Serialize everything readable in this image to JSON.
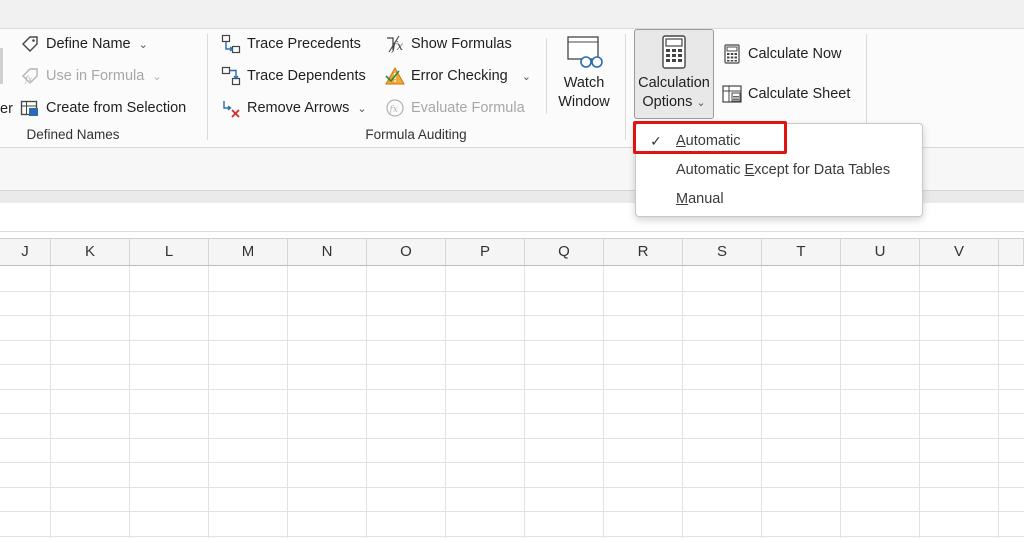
{
  "ribbon": {
    "defined_names": {
      "left_partial": "er",
      "define_name": "Define Name",
      "use_in_formula": "Use in Formula",
      "create_from_selection": "Create from Selection",
      "group_label": "Defined Names"
    },
    "formula_auditing": {
      "trace_precedents": "Trace Precedents",
      "trace_dependents": "Trace Dependents",
      "remove_arrows": "Remove Arrows",
      "show_formulas": "Show Formulas",
      "error_checking": "Error Checking",
      "evaluate_formula": "Evaluate Formula",
      "watch_window_line1": "Watch",
      "watch_window_line2": "Window",
      "group_label": "Formula Auditing"
    },
    "calculation": {
      "options_line1": "Calculation",
      "options_line2": "Options",
      "calculate_now": "Calculate Now",
      "calculate_sheet": "Calculate Sheet"
    }
  },
  "dropdown": {
    "items": [
      {
        "label_pre": "",
        "label_ul": "A",
        "label_post": "utomatic",
        "checked": true
      },
      {
        "label_pre": "Automatic ",
        "label_ul": "E",
        "label_post": "xcept for Data Tables",
        "checked": false
      },
      {
        "label_pre": "",
        "label_ul": "M",
        "label_post": "anual",
        "checked": false
      }
    ]
  },
  "grid": {
    "columns": [
      "J",
      "K",
      "L",
      "M",
      "N",
      "O",
      "P",
      "Q",
      "R",
      "S",
      "T",
      "U",
      "V"
    ]
  },
  "colors": {
    "highlight": "#e11212",
    "icon_blue": "#2b6cb0",
    "error_orange": "#d4730b"
  }
}
